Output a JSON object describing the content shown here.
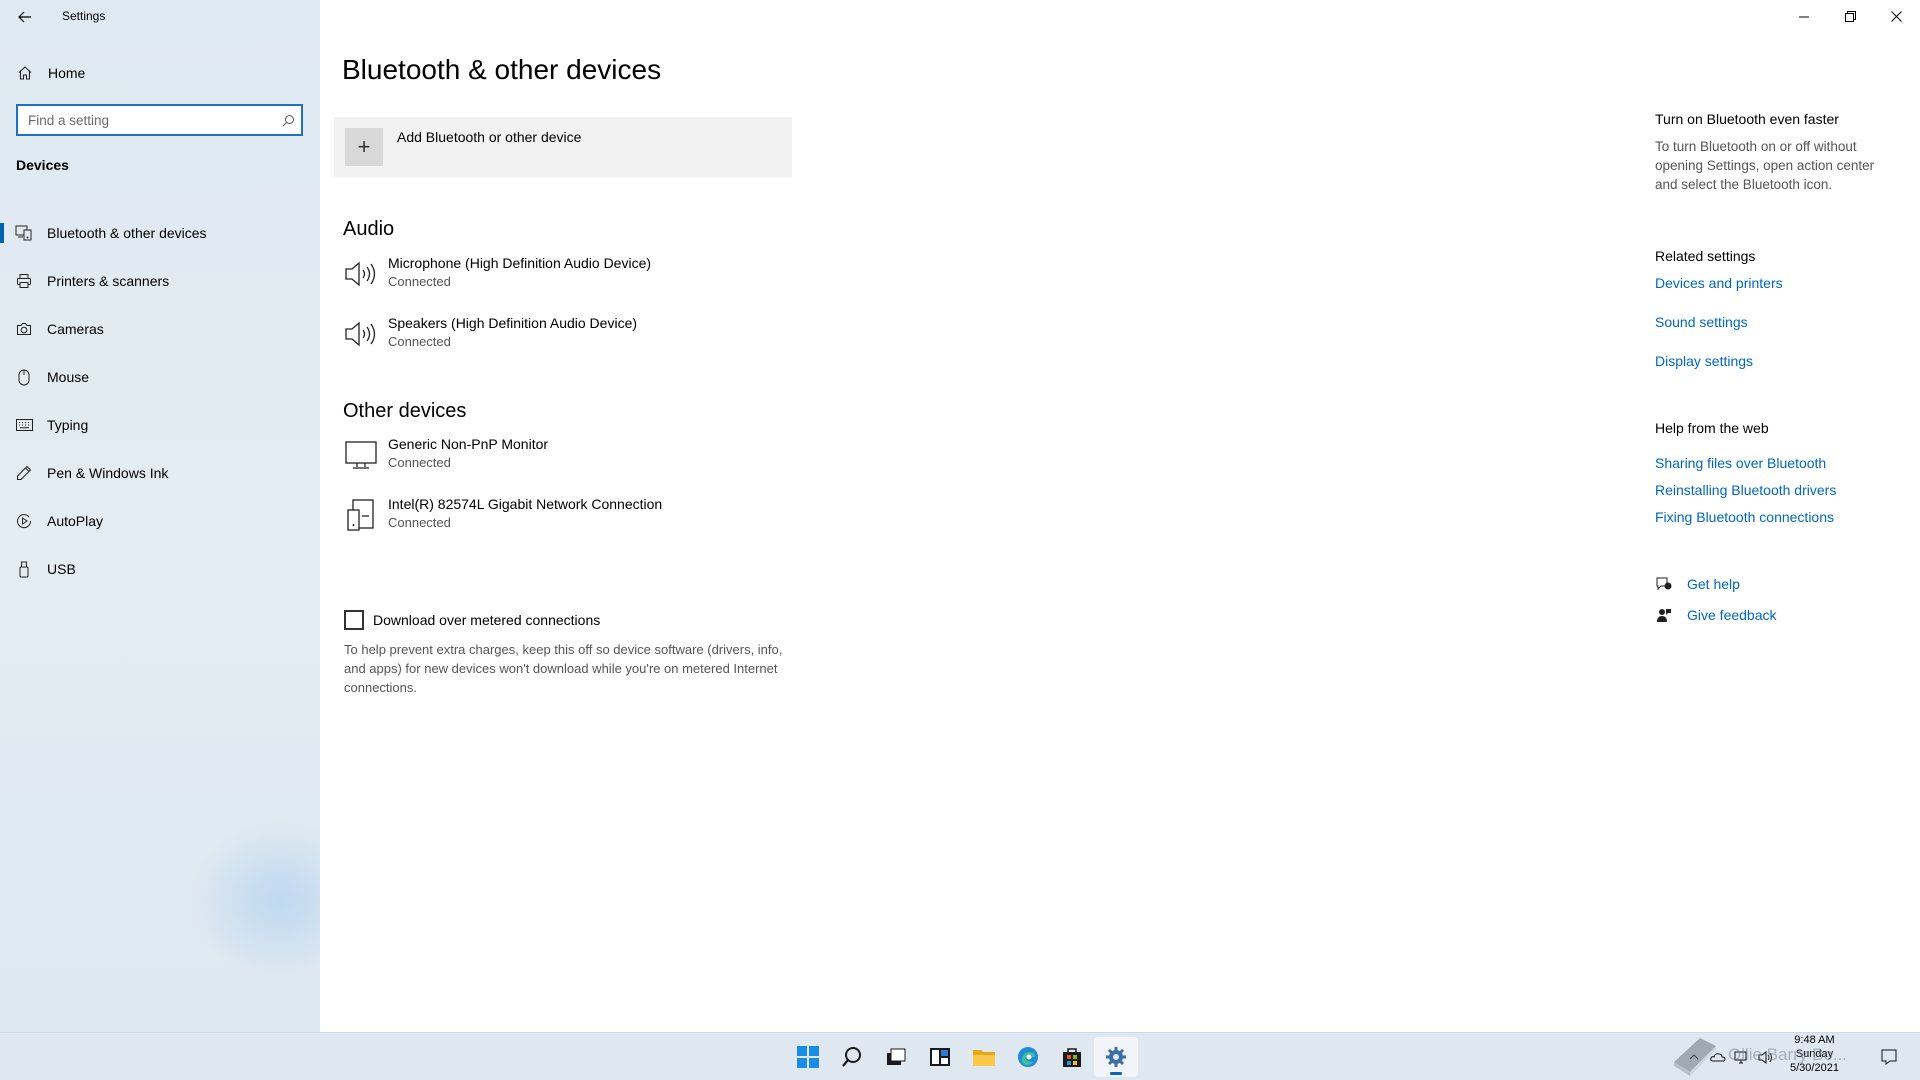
{
  "window": {
    "app_title": "Settings"
  },
  "sidebar": {
    "home_label": "Home",
    "search_placeholder": "Find a setting",
    "section_title": "Devices",
    "items": [
      {
        "label": "Bluetooth & other devices",
        "icon": "bluetooth-devices-icon",
        "active": true
      },
      {
        "label": "Printers & scanners",
        "icon": "printer-icon",
        "active": false
      },
      {
        "label": "Cameras",
        "icon": "camera-icon",
        "active": false
      },
      {
        "label": "Mouse",
        "icon": "mouse-icon",
        "active": false
      },
      {
        "label": "Typing",
        "icon": "keyboard-icon",
        "active": false
      },
      {
        "label": "Pen & Windows Ink",
        "icon": "pen-icon",
        "active": false
      },
      {
        "label": "AutoPlay",
        "icon": "autoplay-icon",
        "active": false
      },
      {
        "label": "USB",
        "icon": "usb-icon",
        "active": false
      }
    ]
  },
  "main": {
    "title": "Bluetooth & other devices",
    "add_device_label": "Add Bluetooth or other device",
    "audio": {
      "heading": "Audio",
      "devices": [
        {
          "name": "Microphone (High Definition Audio Device)",
          "status": "Connected",
          "icon": "speaker-icon"
        },
        {
          "name": "Speakers (High Definition Audio Device)",
          "status": "Connected",
          "icon": "speaker-icon"
        }
      ]
    },
    "other": {
      "heading": "Other devices",
      "devices": [
        {
          "name": "Generic Non-PnP Monitor",
          "status": "Connected",
          "icon": "monitor-icon"
        },
        {
          "name": "Intel(R) 82574L Gigabit Network Connection",
          "status": "Connected",
          "icon": "network-device-icon"
        }
      ]
    },
    "metered": {
      "label": "Download over metered connections",
      "checked": false,
      "description": "To help prevent extra charges, keep this off so device software (drivers, info, and apps) for new devices won't download while you're on metered Internet connections."
    }
  },
  "right": {
    "tip_heading": "Turn on Bluetooth even faster",
    "tip_text": "To turn Bluetooth on or off without opening Settings, open action center and select the Bluetooth icon.",
    "related_heading": "Related settings",
    "related_links": [
      "Devices and printers",
      "Sound settings",
      "Display settings"
    ],
    "help_heading": "Help from the web",
    "help_links": [
      "Sharing files over Bluetooth",
      "Reinstalling Bluetooth drivers",
      "Fixing Bluetooth connections"
    ],
    "get_help": "Get help",
    "give_feedback": "Give feedback"
  },
  "taskbar": {
    "clock_time": "9:48 AM",
    "clock_day": "Sunday",
    "clock_date": "5/30/2021",
    "watermark": "Ollie Barry Bo..."
  },
  "colors": {
    "accent": "#0067c0",
    "sidebar_bg": "#e1ebf3",
    "taskbar_bg": "#dfe8f1"
  }
}
